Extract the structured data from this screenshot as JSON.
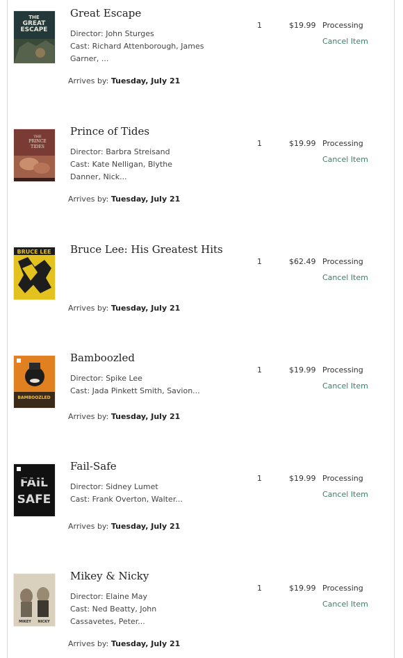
{
  "arrives_prefix": "Arrives by:",
  "accent_color": "#3e7d6a",
  "items": [
    {
      "title": "Great Escape",
      "director": "Director: John Sturges",
      "cast_line1": "Cast: Richard Attenborough, James",
      "cast_line2": "Garner, ...",
      "qty": "1",
      "price": "$19.99",
      "status": "Processing",
      "cancel": "Cancel Item",
      "arrives": "Tuesday, July 21",
      "poster": {
        "text_lines": [
          "THE",
          "GREAT",
          "ESCAPE"
        ]
      }
    },
    {
      "title": "Prince of Tides",
      "director": "Director: Barbra Streisand",
      "cast_line1": "Cast: Kate Nelligan, Blythe",
      "cast_line2": "Danner, Nick...",
      "qty": "1",
      "price": "$19.99",
      "status": "Processing",
      "cancel": "Cancel Item",
      "arrives": "Tuesday, July 21",
      "poster": {
        "text_lines": [
          "THE",
          "PRINCE",
          "TIDES"
        ]
      }
    },
    {
      "title": "Bruce Lee: His Greatest Hits",
      "director": "",
      "cast_line1": "",
      "cast_line2": "",
      "qty": "1",
      "price": "$62.49",
      "status": "Processing",
      "cancel": "Cancel Item",
      "arrives": "Tuesday, July 21",
      "poster": {
        "text_lines": [
          "BRUCE LEE"
        ]
      }
    },
    {
      "title": "Bamboozled",
      "director": "Director: Spike Lee",
      "cast_line1": "Cast: Jada Pinkett Smith, Savion...",
      "cast_line2": "",
      "qty": "1",
      "price": "$19.99",
      "status": "Processing",
      "cancel": "Cancel Item",
      "arrives": "Tuesday, July 21",
      "poster": {
        "text_lines": [
          "BAMBOOZLED"
        ]
      }
    },
    {
      "title": "Fail-Safe",
      "director": "Director: Sidney Lumet",
      "cast_line1": "Cast: Frank Overton, Walter...",
      "cast_line2": "",
      "qty": "1",
      "price": "$19.99",
      "status": "Processing",
      "cancel": "Cancel Item",
      "arrives": "Tuesday, July 21",
      "poster": {
        "text_lines": [
          "FAIL",
          "SAFE"
        ]
      }
    },
    {
      "title": "Mikey & Nicky",
      "director": "Director: Elaine May",
      "cast_line1": "Cast: Ned Beatty, John",
      "cast_line2": "Cassavetes, Peter...",
      "qty": "1",
      "price": "$19.99",
      "status": "Processing",
      "cancel": "Cancel Item",
      "arrives": "Tuesday, July 21",
      "poster": {
        "text_lines": [
          "MIKEY",
          "NICKY"
        ]
      }
    }
  ]
}
